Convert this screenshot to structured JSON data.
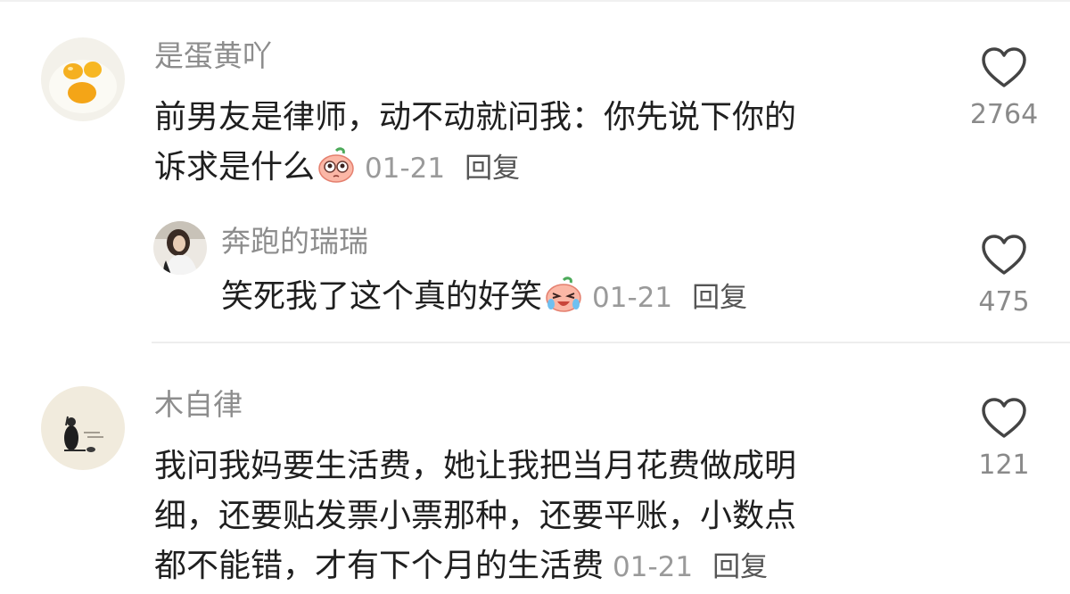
{
  "comments": [
    {
      "username": "是蛋黄吖",
      "text_line1": "前男友是律师，动不动就问我：你先说下你的",
      "text_line2": "诉求是什么",
      "emoji": "thinking-peach-emoji",
      "date": "01-21",
      "reply_label": "回复",
      "likes": "2764",
      "reply": {
        "username": "奔跑的瑞瑞",
        "text": "笑死我了这个真的好笑",
        "emoji": "laughing-crying-peach-emoji",
        "date": "01-21",
        "reply_label": "回复",
        "likes": "475"
      }
    },
    {
      "username": "木自律",
      "text_line1": "我问我妈要生活费，她让我把当月花费做成明",
      "text_line2": "细，还要贴发票小票那种，还要平账，小数点",
      "text_line3": "都不能错，才有下个月的生活费",
      "date": "01-21",
      "reply_label": "回复",
      "likes": "121"
    }
  ],
  "icons": {
    "like": "heart-outline-icon"
  },
  "colors": {
    "username": "#8d8d8d",
    "text": "#1f1f1f",
    "meta": "#9a9a9a",
    "divider": "#ededed"
  }
}
